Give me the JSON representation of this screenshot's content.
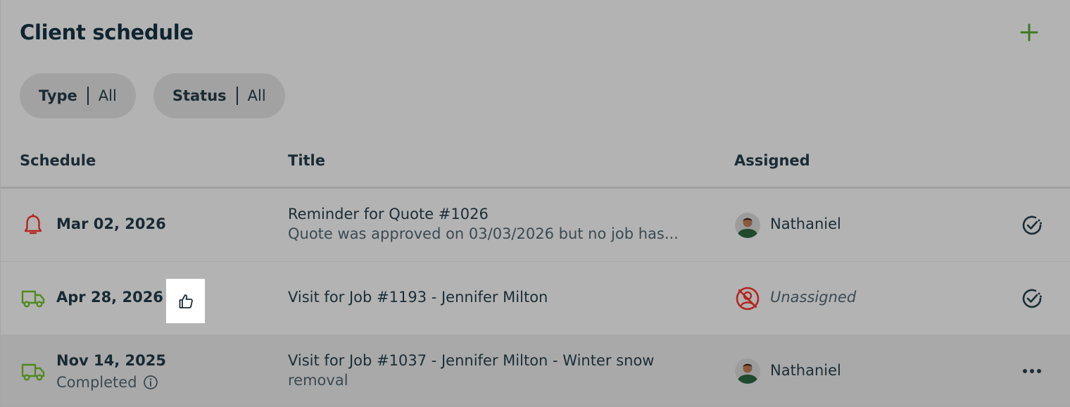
{
  "header": {
    "title": "Client schedule",
    "add_icon": "plus-icon"
  },
  "filters": [
    {
      "label": "Type",
      "value": "All"
    },
    {
      "label": "Status",
      "value": "All"
    }
  ],
  "table": {
    "columns": [
      "Schedule",
      "Title",
      "Assigned"
    ],
    "rows": [
      {
        "icon": "bell-icon",
        "date": "Mar 02, 2026",
        "status": "",
        "title": "Reminder for Quote #1026",
        "subtitle": "Quote was approved on 03/03/2026 but no job has...",
        "assignee": "Nathaniel",
        "action_icon": "check-circle-icon"
      },
      {
        "icon": "truck-icon",
        "date": "Apr 28, 2026",
        "status": "",
        "title": "Visit for Job #1193 - Jennifer Milton",
        "subtitle": "",
        "assignee": "Unassigned",
        "action_icon": "check-circle-icon"
      },
      {
        "icon": "truck-icon",
        "date": "Nov 14, 2025",
        "status": "Completed",
        "title": "Visit for Job #1037 - Jennifer Milton - Winter snow",
        "subtitle": "removal",
        "assignee": "Nathaniel",
        "action_icon": "more-icon"
      }
    ]
  },
  "colors": {
    "accent_green": "#3d7a21",
    "alert_red": "#b3261e",
    "text_dark": "#1c2d36",
    "background": "#b3b3b3"
  }
}
